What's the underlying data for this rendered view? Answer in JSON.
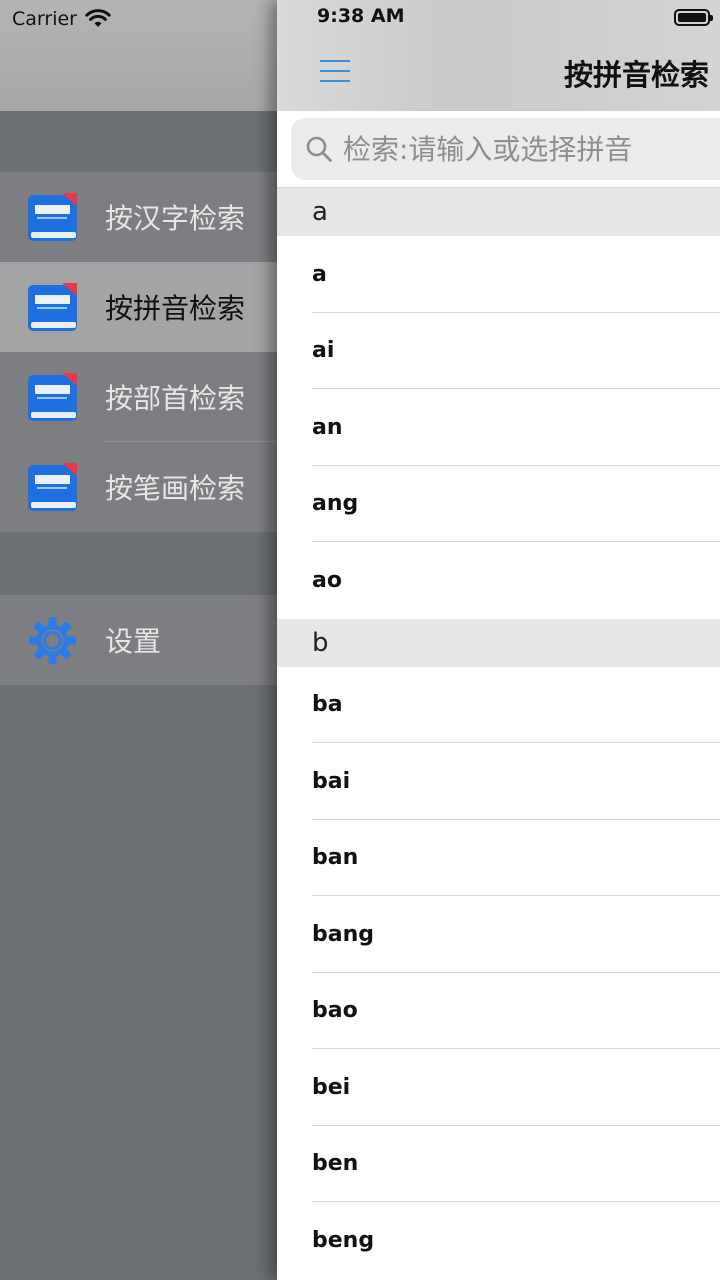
{
  "status_bar": {
    "carrier": "Carrier",
    "time": "9:38 AM"
  },
  "drawer": {
    "menu_items": [
      {
        "label": "按汉字检索",
        "icon": "dictionary-book-icon",
        "active": false
      },
      {
        "label": "按拼音检索",
        "icon": "dictionary-book-icon",
        "active": true
      },
      {
        "label": "按部首检索",
        "icon": "dictionary-book-icon",
        "active": false
      },
      {
        "label": "按笔画检索",
        "icon": "dictionary-book-icon",
        "active": false
      }
    ],
    "settings": {
      "label": "设置",
      "icon": "gear-icon"
    }
  },
  "nav": {
    "title": "按拼音检索",
    "menu_icon": "hamburger-menu-icon"
  },
  "search": {
    "placeholder": "检索:请输入或选择拼音",
    "value": ""
  },
  "sections": [
    {
      "header": "a",
      "rows": [
        "a",
        "ai",
        "an",
        "ang",
        "ao"
      ]
    },
    {
      "header": "b",
      "rows": [
        "ba",
        "bai",
        "ban",
        "bang",
        "bao",
        "bei",
        "ben",
        "beng"
      ]
    }
  ],
  "colors": {
    "accent": "#3a8fd8",
    "book_blue": "#1e6fe0",
    "book_badge": "#e8394a",
    "gear": "#2a7be4"
  }
}
